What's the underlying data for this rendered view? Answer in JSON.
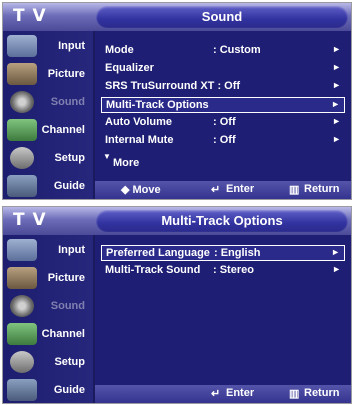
{
  "sidebar": {
    "items": [
      {
        "label": "Input",
        "icon": "input-icon"
      },
      {
        "label": "Picture",
        "icon": "picture-icon"
      },
      {
        "label": "Sound",
        "icon": "sound-icon"
      },
      {
        "label": "Channel",
        "icon": "channel-icon"
      },
      {
        "label": "Setup",
        "icon": "setup-icon"
      },
      {
        "label": "Guide",
        "icon": "guide-icon"
      }
    ]
  },
  "panel1": {
    "tv_label": "T V",
    "title": "Sound",
    "rows": [
      {
        "label": "Mode",
        "value": ": Custom",
        "arrow": "►"
      },
      {
        "label": "Equalizer",
        "value": "",
        "arrow": "►"
      },
      {
        "label": "SRS TruSurround XT : Off",
        "value": "",
        "arrow": "►"
      },
      {
        "label": "Multi-Track Options",
        "value": "",
        "arrow": "►"
      },
      {
        "label": "Auto Volume",
        "value": ": Off",
        "arrow": "►"
      },
      {
        "label": "Internal Mute",
        "value": ": Off",
        "arrow": "►"
      },
      {
        "label": "More",
        "value": "",
        "arrow": ""
      }
    ],
    "footer": {
      "move": "◆ Move",
      "enter": "Enter",
      "return": "Return"
    }
  },
  "panel2": {
    "tv_label": "T V",
    "title": "Multi-Track Options",
    "rows": [
      {
        "label": "Preferred Language",
        "value": ": English",
        "arrow": "►"
      },
      {
        "label": "Multi-Track Sound",
        "value": ": Stereo",
        "arrow": "►"
      }
    ],
    "footer": {
      "enter": "Enter",
      "return": "Return"
    }
  },
  "colors": {
    "background": "#1e1e74",
    "header": "#6c6cb8",
    "selection_border": "#ffffff"
  }
}
